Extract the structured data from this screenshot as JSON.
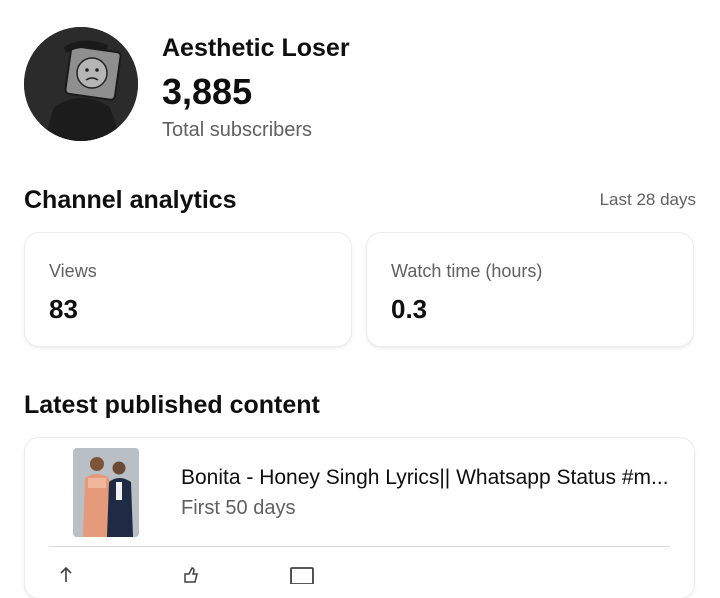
{
  "channel": {
    "name": "Aesthetic Loser",
    "subscriber_count": "3,885",
    "subscriber_label": "Total subscribers"
  },
  "analytics": {
    "title": "Channel analytics",
    "range": "Last 28 days",
    "metrics": [
      {
        "label": "Views",
        "value": "83"
      },
      {
        "label": "Watch time (hours)",
        "value": "0.3"
      }
    ]
  },
  "latest": {
    "title": "Latest published content",
    "video_title": "Bonita - Honey Singh Lyrics|| Whatsapp Status #m...",
    "period": "First 50 days",
    "stat_icons": [
      "views-icon",
      "likes-icon",
      "comments-icon"
    ]
  }
}
